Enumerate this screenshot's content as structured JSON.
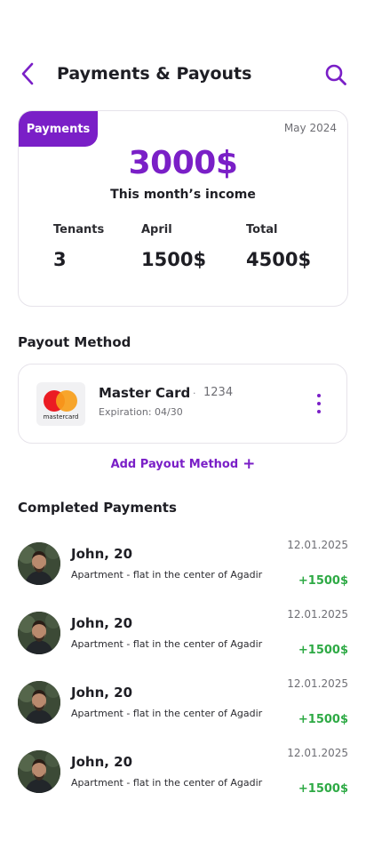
{
  "header": {
    "title": "Payments & Payouts",
    "back_icon": "chevron-left-icon",
    "search_icon": "search-icon"
  },
  "colors": {
    "accent": "#7a1fc7",
    "positive": "#2eaa45",
    "text": "#1e1e24"
  },
  "summary": {
    "tag": "Payments",
    "period": "May 2024",
    "amount": "3000$",
    "amount_label": "This month’s income",
    "stats": [
      {
        "label": "Tenants",
        "value": "3"
      },
      {
        "label": "April",
        "value": "1500$"
      },
      {
        "label": "Total",
        "value": "4500$"
      }
    ]
  },
  "payout": {
    "section_title": "Payout Method",
    "card": {
      "brand_logo_text": "mastercard",
      "name": "Master Card",
      "separator": "·",
      "last4": "1234",
      "expiration": "Expiration: 04/30",
      "menu_icon": "more-vertical-icon"
    },
    "add_label": "Add Payout Method",
    "add_icon": "+"
  },
  "completed": {
    "section_title": "Completed Payments",
    "items": [
      {
        "name": "John, 20",
        "property": "Apartment - flat in the center of Agadir",
        "date": "12.01.2025",
        "amount": "+1500$"
      },
      {
        "name": "John, 20",
        "property": "Apartment - flat in the center of Agadir",
        "date": "12.01.2025",
        "amount": "+1500$"
      },
      {
        "name": "John, 20",
        "property": "Apartment - flat in the center of Agadir",
        "date": "12.01.2025",
        "amount": "+1500$"
      },
      {
        "name": "John, 20",
        "property": "Apartment - flat in the center of Agadir",
        "date": "12.01.2025",
        "amount": "+1500$"
      }
    ]
  }
}
